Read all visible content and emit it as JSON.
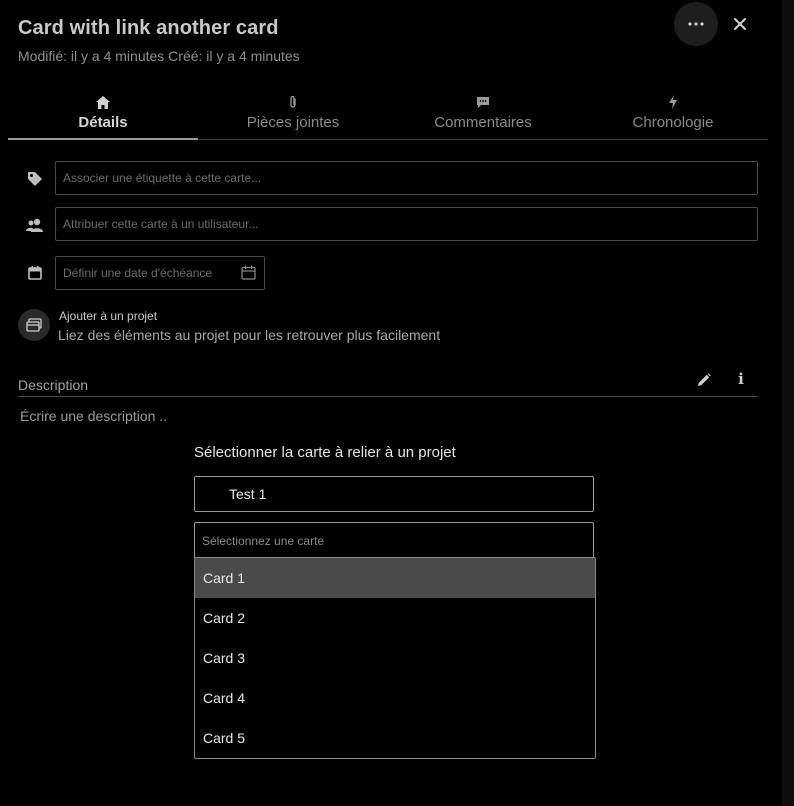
{
  "header": {
    "title": "Card with link another card",
    "subtitle": "Modifié: il y a 4 minutes Créé: il y a 4 minutes"
  },
  "tabs": [
    {
      "label": "Détails",
      "icon": "home-icon"
    },
    {
      "label": "Pièces jointes",
      "icon": "paperclip-icon"
    },
    {
      "label": "Commentaires",
      "icon": "comment-icon"
    },
    {
      "label": "Chronologie",
      "icon": "lightning-icon"
    }
  ],
  "fields": {
    "tags_placeholder": "Associer une étiquette à cette carte...",
    "assign_placeholder": "Attribuer cette carte à un utilisateur...",
    "due_placeholder": "Définir une date d'échéance"
  },
  "project": {
    "title": "Ajouter à un projet",
    "description": "Liez des éléments au projet pour les retrouver plus facilement"
  },
  "description": {
    "label": "Description",
    "placeholder": "Écrire une description ..",
    "info_glyph": "i"
  },
  "link_dialog": {
    "title": "Sélectionner la carte à relier à un projet",
    "project_value": "Test 1",
    "card_placeholder": "Sélectionnez une carte",
    "options": [
      "Card 1",
      "Card 2",
      "Card 3",
      "Card 4",
      "Card 5"
    ],
    "selected_option": "Card 1"
  },
  "colors": {
    "background": "#000000",
    "highlight": "#4a4a4a",
    "text": "#d8d8d8"
  }
}
